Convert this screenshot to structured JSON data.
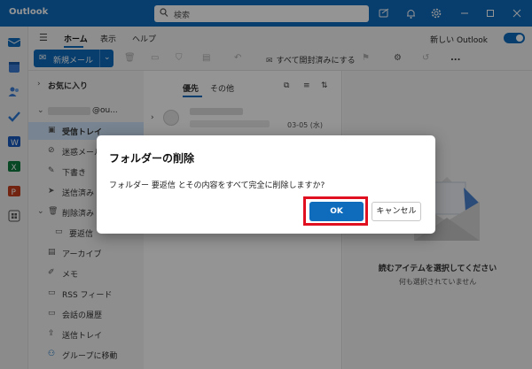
{
  "window": {
    "app_title": "Outlook",
    "search_placeholder": "検索",
    "titlebar_icons": [
      "compose-icon",
      "bell-icon",
      "gear-icon"
    ],
    "controls": [
      "minimize",
      "maximize",
      "close"
    ]
  },
  "ribbon": {
    "tabs": [
      "ホーム",
      "表示",
      "ヘルプ"
    ],
    "active_tab": "ホーム",
    "new_outlook_label": "新しい Outlook",
    "new_outlook_on": true,
    "new_mail_label": "新規メール",
    "mark_all_read_label": "すべて開封済みにする",
    "more_label": "..."
  },
  "folders": {
    "favorites_label": "お気に入り",
    "account_label": "@ou...",
    "items": [
      {
        "name": "受信トレイ",
        "icon": "inbox-icon",
        "selected": true
      },
      {
        "name": "迷惑メール",
        "icon": "junk-icon"
      },
      {
        "name": "下書き",
        "icon": "pencil-icon"
      },
      {
        "name": "送信済み",
        "icon": "send-icon"
      },
      {
        "name": "削除済み",
        "icon": "trash-icon"
      },
      {
        "name": "要返信",
        "icon": "folder-icon"
      },
      {
        "name": "アーカイブ",
        "icon": "archive-icon"
      },
      {
        "name": "メモ",
        "icon": "note-icon"
      },
      {
        "name": "RSS フィード",
        "icon": "rss-icon"
      },
      {
        "name": "会話の履歴",
        "icon": "history-icon"
      },
      {
        "name": "送信トレイ",
        "icon": "outbox-icon"
      },
      {
        "name": "グループに移動",
        "icon": "group-icon"
      }
    ]
  },
  "message_list": {
    "tabs": [
      "優先",
      "その他"
    ],
    "active_tab": "優先",
    "items": [
      {
        "date": "03-05 (水)"
      }
    ]
  },
  "reading_pane": {
    "empty_title": "読むアイテムを選択してください",
    "empty_subtitle": "何も選択されていません"
  },
  "dialog": {
    "title": "フォルダーの削除",
    "message": "フォルダー 要返信 とその内容をすべて完全に削除しますか?",
    "ok_label": "OK",
    "cancel_label": "キャンセル",
    "highlight_color": "#e01020"
  },
  "colors": {
    "accent": "#0f6cbd",
    "selected_bg": "#cfe4fa"
  }
}
